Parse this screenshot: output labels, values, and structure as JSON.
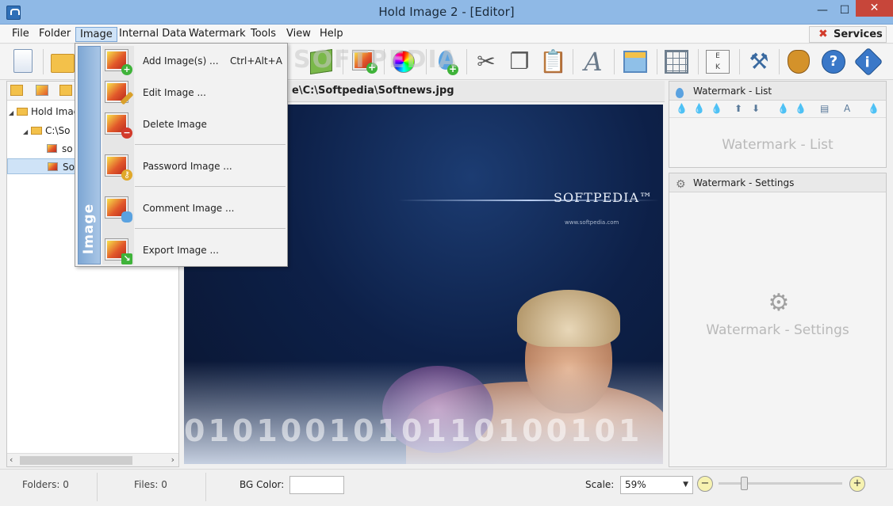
{
  "window": {
    "title": "Hold Image 2 - [Editor]",
    "minimize_glyph": "—",
    "maximize_glyph": "☐",
    "close_glyph": "✕"
  },
  "menubar": {
    "items": [
      "File",
      "Folder",
      "Image",
      "Internal Data",
      "Watermark",
      "Tools",
      "View",
      "Help"
    ],
    "active": "Image",
    "services_label": "Services",
    "services_icon": "close-x-icon"
  },
  "toolbar": {
    "watermark_text": "SOFTPEDIA"
  },
  "image_menu": {
    "side_label": "Image",
    "items": [
      {
        "label": "Add Image(s) ...",
        "shortcut": "Ctrl+Alt+A",
        "icon": "image-add-icon"
      },
      {
        "label": "Edit Image ...",
        "shortcut": "",
        "icon": "image-edit-icon"
      },
      {
        "label": "Delete Image",
        "shortcut": "",
        "icon": "image-delete-icon"
      },
      {
        "label": "Password Image ...",
        "shortcut": "",
        "icon": "image-password-icon"
      },
      {
        "label": "Comment Image ...",
        "shortcut": "",
        "icon": "image-comment-icon"
      },
      {
        "label": "Export Image ...",
        "shortcut": "",
        "icon": "image-export-icon"
      }
    ]
  },
  "tree": {
    "root": "Hold Imag",
    "folder": "C:\\So",
    "files": [
      "so",
      "So"
    ]
  },
  "editor": {
    "path_fragment": "e\\C:\\Softpedia\\Softnews.jpg",
    "image_logo": "SOFTPEDIA™",
    "image_url": "www.softpedia.com",
    "image_digits": "0101001010110100101"
  },
  "watermark_list": {
    "title": "Watermark - List",
    "placeholder": "Watermark - List"
  },
  "watermark_settings": {
    "title": "Watermark - Settings",
    "placeholder": "Watermark - Settings"
  },
  "statusbar": {
    "folders": "Folders: 0",
    "files": "Files: 0",
    "bg_color_label": "BG Color:",
    "scale_label": "Scale:",
    "scale_value": "59%"
  },
  "colors": {
    "titlebar": "#8fb9e6",
    "close_button": "#c7463a",
    "accent": "#7ea7d4"
  }
}
